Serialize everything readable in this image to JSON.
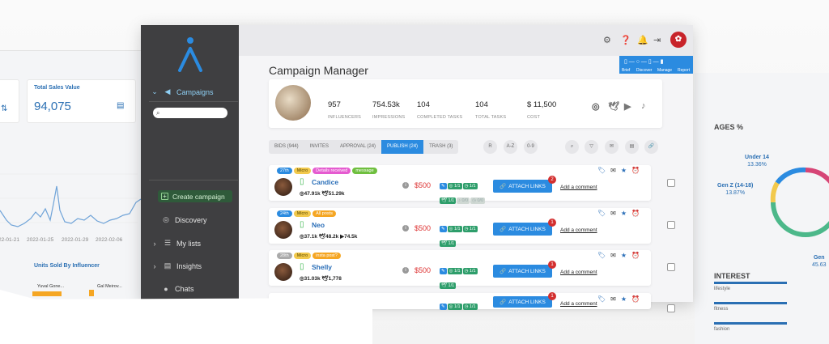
{
  "background_left": {
    "total_sales_label": "Total Sales Value",
    "total_sales_value": "94,075",
    "chart_ticks": [
      "22-01-21",
      "2022-01-25",
      "2022-01-29",
      "2022-02-06"
    ],
    "units_sold_label": "Units Sold By Influencer",
    "bar_name_1": "Yuval Gone...",
    "bar_name_2": "Gal Meirov..."
  },
  "sidebar": {
    "campaigns_label": "Campaigns",
    "create_label": "Create campaign",
    "items": [
      {
        "label": "Discovery"
      },
      {
        "label": "My lists"
      },
      {
        "label": "Insights"
      },
      {
        "label": "Chats"
      }
    ]
  },
  "steps": {
    "brief": "Brief",
    "discover": "Discover",
    "manage": "Manage",
    "report": "Report"
  },
  "main": {
    "title": "Campaign Manager",
    "stats": [
      {
        "value": "957",
        "label": "INFLUENCERS"
      },
      {
        "value": "754.53k",
        "label": "IMPRESSIONS"
      },
      {
        "value": "104",
        "label": "COMPLETED TASKS"
      },
      {
        "value": "104",
        "label": "TOTAL TASKS"
      },
      {
        "value": "$ 11,500",
        "label": "COST"
      }
    ],
    "tabs": [
      {
        "label": "BIDS (944)"
      },
      {
        "label": "INVITES"
      },
      {
        "label": "APPROVAL (24)"
      },
      {
        "label": "PUBLISH (24)"
      },
      {
        "label": "TRASH (3)"
      }
    ],
    "sort_buttons": [
      "R",
      "A-Z",
      "0-9"
    ],
    "attach_label": "ATTACH LINKS",
    "comment_label": "Add a comment",
    "rows": [
      {
        "rank": "27th",
        "tier": "Micro",
        "tag1": "Details received",
        "tag2": "message",
        "name": "Candice",
        "insta": "47.91k",
        "twitter": "51.29k",
        "youtube": "",
        "price": "$500",
        "badge": "2"
      },
      {
        "rank": "24th",
        "tier": "Micro",
        "tag1": "All posts",
        "tag2": "",
        "name": "Neo",
        "insta": "37.1k",
        "twitter": "48.2k",
        "youtube": "74.5k",
        "price": "$500",
        "badge": "1"
      },
      {
        "rank": "28th",
        "tier": "Micro",
        "tag1": "insta post?",
        "tag2": "",
        "name": "Shelly",
        "insta": "31.03k",
        "twitter": "1,778",
        "youtube": "",
        "price": "$500",
        "badge": "1"
      },
      {
        "rank": "",
        "tier": "",
        "tag1": "",
        "tag2": "",
        "name": "",
        "insta": "",
        "twitter": "",
        "youtube": "",
        "price": "",
        "badge": "1"
      }
    ],
    "task_counts": [
      "1/1",
      "1/1",
      "1/1",
      "0/0",
      "0/0"
    ]
  },
  "background_right": {
    "ages_title": "AGES %",
    "age_under14_label": "Under 14",
    "age_under14_value": "13.36%",
    "age_genz_label": "Gen Z (14-18)",
    "age_genz_value": "13.87%",
    "age_gen_label": "Gen",
    "age_gen_value": "45.63",
    "interest_title": "INTEREST",
    "interests": [
      "lifestyle",
      "fitness",
      "fashion"
    ]
  },
  "colors": {
    "accent": "#2b8be0",
    "sidebar": "#3f3f41",
    "price": "#d33333",
    "brand_red": "#c8242a"
  }
}
